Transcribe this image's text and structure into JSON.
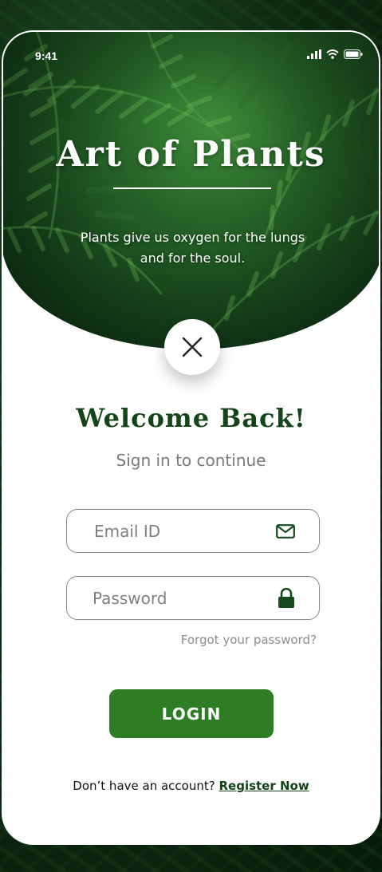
{
  "status_bar": {
    "time": "9:41",
    "icons": [
      "signal-icon",
      "wifi-icon",
      "battery-icon"
    ]
  },
  "hero": {
    "title": "Art of Plants",
    "tagline": "Plants give us oxygen for the lungs and for the soul."
  },
  "close_icon": "close-icon",
  "welcome": {
    "title": "Welcome Back!",
    "subtitle": "Sign in to continue"
  },
  "form": {
    "email_placeholder": "Email ID",
    "email_value": "",
    "email_icon": "mail-icon",
    "password_placeholder": "Password",
    "password_value": "",
    "password_icon": "lock-icon",
    "forgot_label": "Forgot your password?",
    "login_label": "LOGIN"
  },
  "register": {
    "prompt": "Don’t have an account?",
    "link_label": "Register Now"
  },
  "colors": {
    "brand_green": "#2e7d25",
    "heading_green": "#16441a"
  }
}
